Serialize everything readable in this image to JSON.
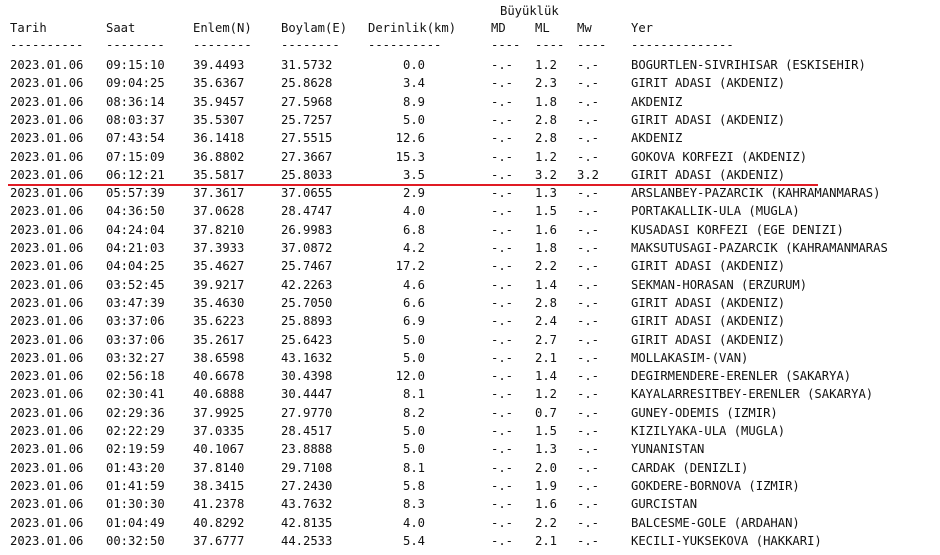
{
  "header": {
    "group_label": "Büyüklük",
    "columns": [
      "Tarih",
      "Saat",
      "Enlem(N)",
      "Boylam(E)",
      "Derinlik(km)",
      "MD",
      "ML",
      "Mw",
      "Yer"
    ],
    "separators": [
      "----------",
      "--------",
      "--------",
      "--------",
      "----------",
      "----",
      "----",
      "----",
      "--------------"
    ]
  },
  "rows": [
    [
      "2023.01.06",
      "09:15:10",
      "39.4493",
      "31.5732",
      "0.0",
      "-.-",
      "1.2",
      "-.-",
      "BOGURTLEN-SIVRIHISAR (ESKISEHIR)"
    ],
    [
      "2023.01.06",
      "09:04:25",
      "35.6367",
      "25.8628",
      "3.4",
      "-.-",
      "2.3",
      "-.-",
      "GIRIT ADASI (AKDENIZ)"
    ],
    [
      "2023.01.06",
      "08:36:14",
      "35.9457",
      "27.5968",
      "8.9",
      "-.-",
      "1.8",
      "-.-",
      "AKDENIZ"
    ],
    [
      "2023.01.06",
      "08:03:37",
      "35.5307",
      "25.7257",
      "5.0",
      "-.-",
      "2.8",
      "-.-",
      "GIRIT ADASI (AKDENIZ)"
    ],
    [
      "2023.01.06",
      "07:43:54",
      "36.1418",
      "27.5515",
      "12.6",
      "-.-",
      "2.8",
      "-.-",
      "AKDENIZ"
    ],
    [
      "2023.01.06",
      "07:15:09",
      "36.8802",
      "27.3667",
      "15.3",
      "-.-",
      "1.2",
      "-.-",
      "GOKOVA KORFEZI (AKDENIZ)"
    ],
    [
      "2023.01.06",
      "06:12:21",
      "35.5817",
      "25.8033",
      "3.5",
      "-.-",
      "3.2",
      "3.2",
      "GIRIT ADASI (AKDENIZ)"
    ],
    [
      "2023.01.06",
      "05:57:39",
      "37.3617",
      "37.0655",
      "2.9",
      "-.-",
      "1.3",
      "-.-",
      "ARSLANBEY-PAZARCIK (KAHRAMANMARAS)"
    ],
    [
      "2023.01.06",
      "04:36:50",
      "37.0628",
      "28.4747",
      "4.0",
      "-.-",
      "1.5",
      "-.-",
      "PORTAKALLIK-ULA (MUGLA)"
    ],
    [
      "2023.01.06",
      "04:24:04",
      "37.8210",
      "26.9983",
      "6.8",
      "-.-",
      "1.6",
      "-.-",
      "KUSADASI KORFEZI (EGE DENIZI)"
    ],
    [
      "2023.01.06",
      "04:21:03",
      "37.3933",
      "37.0872",
      "4.2",
      "-.-",
      "1.8",
      "-.-",
      "MAKSUTUSAGI-PAZARCIK (KAHRAMANMARAS"
    ],
    [
      "2023.01.06",
      "04:04:25",
      "35.4627",
      "25.7467",
      "17.2",
      "-.-",
      "2.2",
      "-.-",
      "GIRIT ADASI (AKDENIZ)"
    ],
    [
      "2023.01.06",
      "03:52:45",
      "39.9217",
      "42.2263",
      "4.6",
      "-.-",
      "1.4",
      "-.-",
      "SEKMAN-HORASAN (ERZURUM)"
    ],
    [
      "2023.01.06",
      "03:47:39",
      "35.4630",
      "25.7050",
      "6.6",
      "-.-",
      "2.8",
      "-.-",
      "GIRIT ADASI (AKDENIZ)"
    ],
    [
      "2023.01.06",
      "03:37:06",
      "35.6223",
      "25.8893",
      "6.9",
      "-.-",
      "2.4",
      "-.-",
      "GIRIT ADASI (AKDENIZ)"
    ],
    [
      "2023.01.06",
      "03:37:06",
      "35.2617",
      "25.6423",
      "5.0",
      "-.-",
      "2.7",
      "-.-",
      "GIRIT ADASI (AKDENIZ)"
    ],
    [
      "2023.01.06",
      "03:32:27",
      "38.6598",
      "43.1632",
      "5.0",
      "-.-",
      "2.1",
      "-.-",
      "MOLLAKASIM-(VAN)"
    ],
    [
      "2023.01.06",
      "02:56:18",
      "40.6678",
      "30.4398",
      "12.0",
      "-.-",
      "1.4",
      "-.-",
      "DEGIRMENDERE-ERENLER (SAKARYA)"
    ],
    [
      "2023.01.06",
      "02:30:41",
      "40.6888",
      "30.4447",
      "8.1",
      "-.-",
      "1.2",
      "-.-",
      "KAYALARRESITBEY-ERENLER (SAKARYA)"
    ],
    [
      "2023.01.06",
      "02:29:36",
      "37.9925",
      "27.9770",
      "8.2",
      "-.-",
      "0.7",
      "-.-",
      "GUNEY-ODEMIS (IZMIR)"
    ],
    [
      "2023.01.06",
      "02:22:29",
      "37.0335",
      "28.4517",
      "5.0",
      "-.-",
      "1.5",
      "-.-",
      "KIZILYAKA-ULA (MUGLA)"
    ],
    [
      "2023.01.06",
      "02:19:59",
      "40.1067",
      "23.8888",
      "5.0",
      "-.-",
      "1.3",
      "-.-",
      "YUNANISTAN"
    ],
    [
      "2023.01.06",
      "01:43:20",
      "37.8140",
      "29.7108",
      "8.1",
      "-.-",
      "2.0",
      "-.-",
      "CARDAK (DENIZLI)"
    ],
    [
      "2023.01.06",
      "01:41:59",
      "38.3415",
      "27.2430",
      "5.8",
      "-.-",
      "1.9",
      "-.-",
      "GOKDERE-BORNOVA (IZMIR)"
    ],
    [
      "2023.01.06",
      "01:30:30",
      "41.2378",
      "43.7632",
      "8.3",
      "-.-",
      "1.6",
      "-.-",
      "GURCISTAN"
    ],
    [
      "2023.01.06",
      "01:04:49",
      "40.8292",
      "42.8135",
      "4.0",
      "-.-",
      "2.2",
      "-.-",
      "BALCESME-GOLE (ARDAHAN)"
    ],
    [
      "2023.01.06",
      "00:32:50",
      "37.6777",
      "44.2533",
      "5.4",
      "-.-",
      "2.1",
      "-.-",
      "KECILI-YUKSEKOVA (HAKKARI)"
    ]
  ],
  "highlight": {
    "row_index": 6,
    "color": "#e01b24"
  }
}
